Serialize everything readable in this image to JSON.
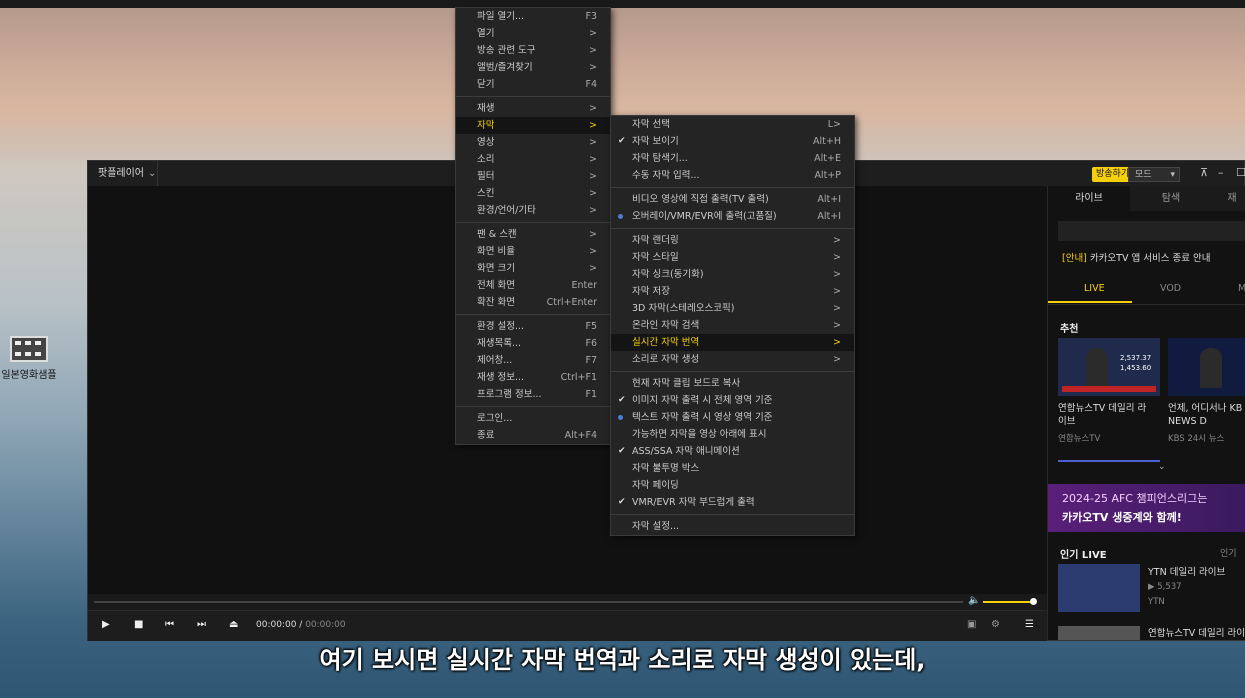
{
  "desktop": {
    "icon_label": "일본영화샘플"
  },
  "player": {
    "app_name": "팟플레이어",
    "broadcast_button": "방송하기",
    "mode_label": "모드",
    "time_current": "00:00:00",
    "time_total": "00:00:00"
  },
  "sidebar": {
    "tabs": [
      "라이브",
      "탐색",
      "재"
    ],
    "notice_tag": "[안내]",
    "notice_text": "카카오TV 앱 서비스 종료 안내",
    "subtabs": [
      "LIVE",
      "VOD",
      "M"
    ],
    "recommend_title": "추천",
    "cards": [
      {
        "title1": "연합뉴스TV 데일리 라",
        "title2": "이브",
        "channel": "연합뉴스TV"
      },
      {
        "title1": "언제, 어디서나 KB",
        "title2": "NEWS D",
        "channel": "KBS 24시 뉴스"
      }
    ],
    "thumb1_nums": [
      "2,537.37",
      "1,453.60"
    ],
    "banner_line1": "2024-25 AFC 챔피언스리그는",
    "banner_line2": "카카오TV 생중계와 함께!",
    "popular_title": "인기 LIVE",
    "popular_more": "인기",
    "popular_items": [
      {
        "title": "YTN 데일리 라이브",
        "views": "▶ 5,537",
        "channel": "YTN"
      },
      {
        "title": "연합뉴스TV 데일리 라이"
      }
    ]
  },
  "main_menu": {
    "groups": [
      [
        {
          "label": "파일 열기...",
          "shortcut": "F3"
        },
        {
          "label": "열기",
          "shortcut": ">"
        },
        {
          "label": "방송 관련 도구",
          "shortcut": ">"
        },
        {
          "label": "앨범/즐겨찾기",
          "shortcut": ">"
        },
        {
          "label": "닫기",
          "shortcut": "F4"
        }
      ],
      [
        {
          "label": "재생",
          "shortcut": ">"
        },
        {
          "label": "자막",
          "shortcut": ">"
        },
        {
          "label": "영상",
          "shortcut": ">"
        },
        {
          "label": "소리",
          "shortcut": ">"
        },
        {
          "label": "필터",
          "shortcut": ">"
        },
        {
          "label": "스킨",
          "shortcut": ">"
        },
        {
          "label": "환경/언어/기타",
          "shortcut": ">"
        }
      ],
      [
        {
          "label": "팬 & 스캔",
          "shortcut": ">"
        },
        {
          "label": "화면 비율",
          "shortcut": ">"
        },
        {
          "label": "화면 크기",
          "shortcut": ">"
        },
        {
          "label": "전체 화면",
          "shortcut": "Enter"
        },
        {
          "label": "확잔 화면",
          "shortcut": "Ctrl+Enter"
        }
      ],
      [
        {
          "label": "환경 설정...",
          "shortcut": "F5"
        },
        {
          "label": "재생목록...",
          "shortcut": "F6"
        },
        {
          "label": "제어창...",
          "shortcut": "F7"
        },
        {
          "label": "재생 정보...",
          "shortcut": "Ctrl+F1"
        },
        {
          "label": "프로그램 정보...",
          "shortcut": "F1"
        }
      ],
      [
        {
          "label": "로그인..."
        },
        {
          "label": "종료",
          "shortcut": "Alt+F4"
        }
      ]
    ],
    "highlighted": "자막"
  },
  "subtitle_menu": {
    "groups": [
      [
        {
          "label": "자막 선택",
          "shortcut": "L>"
        },
        {
          "label": "자막 보이기",
          "shortcut": "Alt+H",
          "mark": "check"
        },
        {
          "label": "자막 탐색기...",
          "shortcut": "Alt+E"
        },
        {
          "label": "수동 자막 입력...",
          "shortcut": "Alt+P"
        }
      ],
      [
        {
          "label": "비디오 영상에 직접 출력(TV 출력)",
          "shortcut": "Alt+I"
        },
        {
          "label": "오버레이/VMR/EVR에 출력(고품질)",
          "shortcut": "Alt+I",
          "mark": "dot"
        }
      ],
      [
        {
          "label": "자막 랜더링",
          "shortcut": ">"
        },
        {
          "label": "자막 스타일",
          "shortcut": ">"
        },
        {
          "label": "자막 싱크(동기화)",
          "shortcut": ">"
        },
        {
          "label": "자막 저장",
          "shortcut": ">"
        },
        {
          "label": "3D 자막(스테레오스코픽)",
          "shortcut": ">"
        },
        {
          "label": "온라인 자막 검색",
          "shortcut": ">"
        },
        {
          "label": "실시간 자막 번역",
          "shortcut": ">"
        },
        {
          "label": "소리로 자막 생성",
          "shortcut": ">"
        }
      ],
      [
        {
          "label": "현재 자막 클립 보드로 복사"
        },
        {
          "label": "이미지 자막 출력 시 전체 영역 기준",
          "mark": "check"
        },
        {
          "label": "텍스트 자막 출력 시 영상 영역 기준",
          "mark": "dot"
        },
        {
          "label": "가능하면 자막을 영상 아래에 표시"
        },
        {
          "label": "ASS/SSA 자막 애니메이션",
          "mark": "check"
        },
        {
          "label": "자막 불투명 박스"
        },
        {
          "label": "자막 페이딩"
        },
        {
          "label": "VMR/EVR 자막 부드럽게 출력",
          "mark": "check"
        }
      ],
      [
        {
          "label": "자막 설정..."
        }
      ]
    ],
    "highlighted": "실시간 자막 번역"
  },
  "caption": "여기 보시면 실시간 자막 번역과 소리로 자막 생성이 있는데,"
}
